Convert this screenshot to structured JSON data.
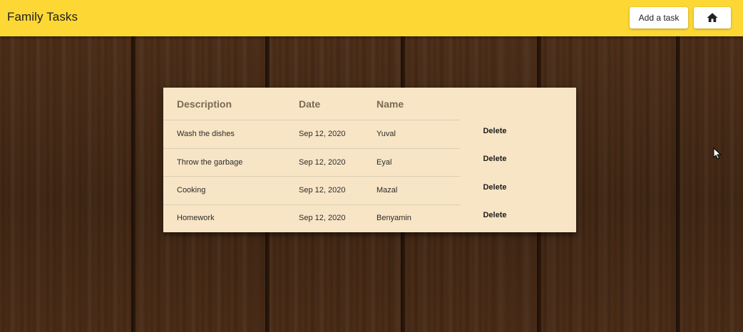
{
  "app": {
    "title": "Family Tasks",
    "add_task_label": "Add a task",
    "home_icon": "home-icon"
  },
  "colors": {
    "toolbar": "#fdd835",
    "card": "#f8e5c5",
    "header_text": "#7a6a55"
  },
  "table": {
    "headers": {
      "description": "Description",
      "date": "Date",
      "name": "Name"
    },
    "rows": [
      {
        "description": "Wash the dishes",
        "date": "Sep 12, 2020",
        "name": "Yuval",
        "action": "Delete"
      },
      {
        "description": "Throw the garbage",
        "date": "Sep 12, 2020",
        "name": "Eyal",
        "action": "Delete"
      },
      {
        "description": "Cooking",
        "date": "Sep 12, 2020",
        "name": "Mazal",
        "action": "Delete"
      },
      {
        "description": "Homework",
        "date": "Sep 12, 2020",
        "name": "Benyamin",
        "action": "Delete"
      }
    ]
  }
}
